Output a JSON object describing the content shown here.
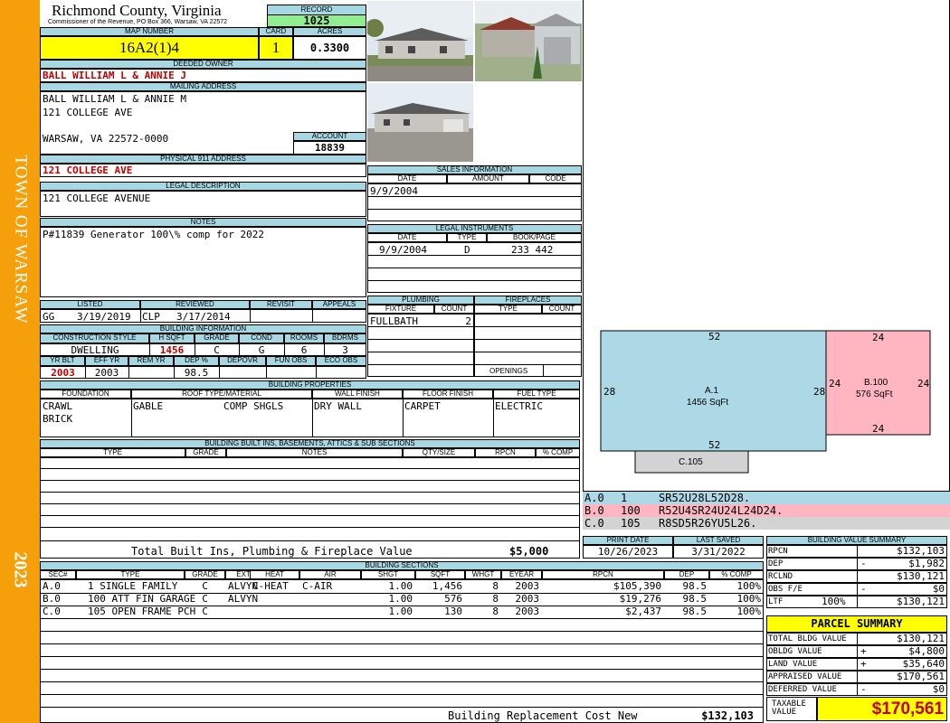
{
  "side": {
    "town": "TOWN OF WARSAW",
    "year": "2023"
  },
  "header": {
    "county": "Richmond County, Virginia",
    "commissioner": "Commissioner of the Revenue, PO Box 366, Warsaw, VA 22572",
    "record_label": "RECORD",
    "record": "1025",
    "map_label": "MAP NUMBER",
    "map": "16A2(1)4",
    "card_label": "CARD",
    "card": "1",
    "acres_label": "ACRES",
    "acres": "0.3300"
  },
  "owner": {
    "label": "DEEDED OWNER",
    "value": "BALL WILLIAM L & ANNIE J"
  },
  "mailing": {
    "label": "MAILING ADDRESS",
    "line1": "BALL WILLIAM L & ANNIE M",
    "line2": "121 COLLEGE AVE",
    "line3": "WARSAW, VA 22572-0000"
  },
  "account": {
    "label": "ACCOUNT",
    "value": "18839"
  },
  "physical": {
    "label": "PHYSICAL 911 ADDRESS",
    "value": "121 COLLEGE AVE"
  },
  "legal": {
    "label": "LEGAL DESCRIPTION",
    "value": "121 COLLEGE AVENUE"
  },
  "notes": {
    "label": "NOTES",
    "value": "P#11839 Generator 100\\% comp for 2022"
  },
  "listed": {
    "labels": [
      "LISTED",
      "REVIEWED",
      "REVISIT",
      "APPEALS"
    ],
    "listed_by": "GG",
    "listed_date": "3/19/2019",
    "reviewed_by": "CLP",
    "reviewed_date": "3/17/2014"
  },
  "building_info": {
    "label": "BUILDING INFORMATION",
    "cols": [
      "CONSTRUCTION STYLE",
      "H SQFT",
      "GRADE",
      "COND",
      "ROOMS",
      "BDRMS"
    ],
    "style": "DWELLING",
    "hsqft": "1456",
    "grade": "C",
    "cond": "G",
    "rooms": "6",
    "bdrms": "3",
    "cols2": [
      "YR BLT",
      "EFF YR",
      "REM YR",
      "DEP %",
      "DEPOVR",
      "FUN OBS",
      "ECO OBS"
    ],
    "yr_blt": "2003",
    "eff_yr": "2003",
    "dep": "98.5"
  },
  "sales": {
    "label": "SALES INFORMATION",
    "cols": [
      "DATE",
      "AMOUNT",
      "CODE"
    ],
    "date": "9/9/2004"
  },
  "legal_instr": {
    "label": "LEGAL INSTRUMENTS",
    "cols": [
      "DATE",
      "TYPE",
      "BOOK/PAGE"
    ],
    "date": "9/9/2004",
    "type": "D",
    "book": "233 442"
  },
  "plumbing": {
    "label": "PLUMBING",
    "cols": [
      "FIXTURE",
      "COUNT"
    ],
    "fixture": "FULLBATH",
    "count": "2"
  },
  "fireplaces": {
    "label": "FIREPLACES",
    "cols": [
      "TYPE",
      "COUNT"
    ],
    "openings": "OPENINGS"
  },
  "properties": {
    "label": "BUILDING PROPERTIES",
    "cols": [
      "FOUNDATION",
      "ROOF TYPE/MATERIAL",
      "WALL FINISH",
      "FLOOR FINISH",
      "FUEL TYPE"
    ],
    "foundation1": "CRAWL",
    "foundation2": "BRICK",
    "roof_type": "GABLE",
    "roof_mat": "COMP SHGLS",
    "wall": "DRY WALL",
    "floor": "CARPET",
    "fuel": "ELECTRIC"
  },
  "builtins": {
    "label": "BUILDING BUILT INS, BASEMENTS, ATTICS & SUB SECTIONS",
    "cols": [
      "TYPE",
      "GRADE",
      "NOTES",
      "QTY/SIZE",
      "RPCN",
      "% COMP"
    ],
    "total_label": "Total Built Ins, Plumbing & Fireplace Value",
    "total": "$5,000"
  },
  "print": {
    "print_label": "PRINT DATE",
    "print": "10/26/2023",
    "saved_label": "LAST SAVED",
    "saved": "3/31/2022"
  },
  "sketch": {
    "a_label": "A.1",
    "a_area": "1456 SqFt",
    "a_top": "52",
    "a_bottom": "52",
    "a_left": "28",
    "a_right": "28",
    "b_label": "B.100",
    "b_area": "576 SqFt",
    "b_top": "24",
    "b_bottom": "24",
    "b_left": "24",
    "b_right": "24",
    "c_label": "C.105",
    "colors": {
      "a": "#add8e6",
      "b": "#ffb6c1",
      "c": "#d3d3d3"
    }
  },
  "codes": [
    {
      "sec": "A.0",
      "num": "1",
      "code": "SR52U28L52D28."
    },
    {
      "sec": "B.0",
      "num": "100",
      "code": "R52U4SR24U24L24D24."
    },
    {
      "sec": "C.0",
      "num": "105",
      "code": "R8SD5R26YU5L26."
    }
  ],
  "sections": {
    "label": "BUILDING SECTIONS",
    "cols": [
      "SEC#",
      "TYPE",
      "GRADE",
      "EXT FIN",
      "HEAT",
      "AIR",
      "SHGT",
      "SQFT",
      "WHGT",
      "EYEAR",
      "RPCN",
      "DEP",
      "% COMP"
    ],
    "rows": [
      {
        "sec": "A.0",
        "type": "1 SINGLE FAMILY",
        "grade": "C",
        "ext": "ALVYN",
        "heat": "C-HEAT",
        "air": "C-AIR",
        "shgt": "1.00",
        "sqft": "1,456",
        "whgt": "8",
        "eyear": "2003",
        "rpcn": "$105,390",
        "dep": "98.5",
        "comp": "100%"
      },
      {
        "sec": "B.0",
        "type": "100 ATT FIN GARAGE",
        "grade": "C",
        "ext": "ALVYN",
        "heat": "",
        "air": "",
        "shgt": "1.00",
        "sqft": "576",
        "whgt": "8",
        "eyear": "2003",
        "rpcn": "$19,276",
        "dep": "98.5",
        "comp": "100%"
      },
      {
        "sec": "C.0",
        "type": "105 OPEN FRAME PCH",
        "grade": "C",
        "ext": "",
        "heat": "",
        "air": "",
        "shgt": "1.00",
        "sqft": "130",
        "whgt": "8",
        "eyear": "2003",
        "rpcn": "$2,437",
        "dep": "98.5",
        "comp": "100%"
      }
    ],
    "replacement_label": "Building Replacement Cost New",
    "replacement": "$132,103"
  },
  "value_summary": {
    "label": "BUILDING VALUE SUMMARY",
    "rows": [
      {
        "label": "RPCN",
        "sign": "",
        "value": "$132,103"
      },
      {
        "label": "DEP",
        "sign": "-",
        "value": "$1,982"
      },
      {
        "label": "RCLND",
        "sign": "",
        "value": "$130,121"
      },
      {
        "label": "OBS F/E",
        "sign": "-",
        "value": "$0"
      },
      {
        "label": "LTF",
        "sign": "100%",
        "value": "$130,121"
      }
    ]
  },
  "parcel": {
    "label": "PARCEL SUMMARY",
    "rows": [
      {
        "label": "TOTAL BLDG VALUE",
        "sign": "",
        "value": "$130,121"
      },
      {
        "label": "OBLDG VALUE",
        "sign": "+",
        "value": "$4,800"
      },
      {
        "label": "LAND VALUE",
        "sign": "+",
        "value": "$35,640"
      },
      {
        "label": "APPRAISED VALUE",
        "sign": "",
        "value": "$170,561"
      },
      {
        "label": "DEFERRED VALUE",
        "sign": "-",
        "value": "$0"
      }
    ],
    "taxable_label": "TAXABLE VALUE",
    "taxable": "$170,561",
    "colors": {
      "yellow": "#ffff00",
      "red": "#c00000"
    }
  }
}
